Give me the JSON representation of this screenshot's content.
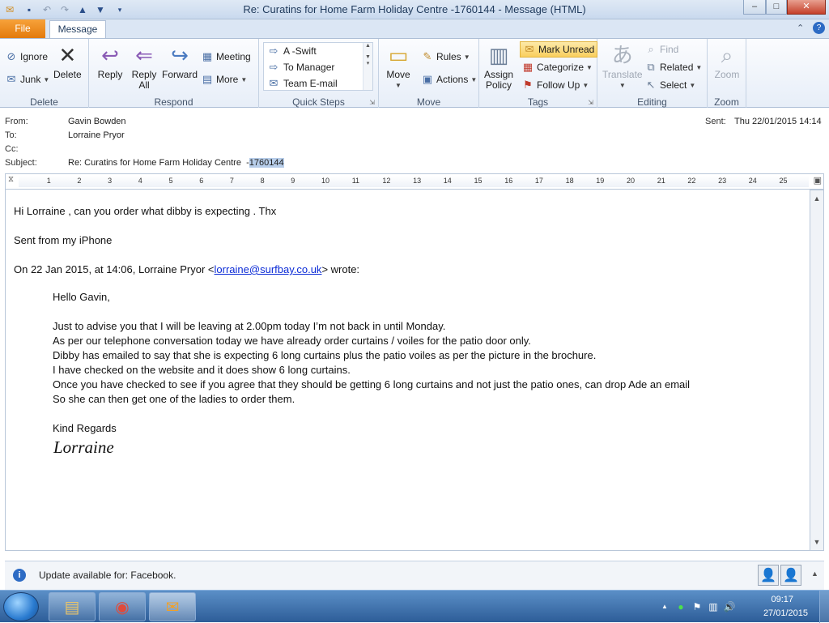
{
  "window": {
    "title": "Re: Curatins for Home Farm Holiday Centre  -1760144  -  Message (HTML)",
    "minimize": "–",
    "maximize": "□",
    "close": "✕"
  },
  "tabs": {
    "file": "File",
    "message": "Message"
  },
  "ribbon": {
    "delete": {
      "label": "Delete",
      "ignore": "Ignore",
      "junk": "Junk",
      "delete": "Delete"
    },
    "respond": {
      "label": "Respond",
      "reply": "Reply",
      "reply_all_1": "Reply",
      "reply_all_2": "All",
      "forward": "Forward",
      "meeting": "Meeting",
      "more": "More"
    },
    "quick_steps": {
      "label": "Quick Steps",
      "items": [
        "A -Swift",
        "To Manager",
        "Team E-mail"
      ]
    },
    "move": {
      "label": "Move",
      "move": "Move",
      "rules": "Rules",
      "actions": "Actions"
    },
    "tags": {
      "label": "Tags",
      "assign_policy_1": "Assign",
      "assign_policy_2": "Policy",
      "mark_unread": "Mark Unread",
      "categorize": "Categorize",
      "follow_up": "Follow Up"
    },
    "editing": {
      "label": "Editing",
      "translate": "Translate",
      "find": "Find",
      "related": "Related",
      "select": "Select"
    },
    "zoom": {
      "label": "Zoom",
      "zoom": "Zoom"
    }
  },
  "header": {
    "from_label": "From:",
    "from": "Gavin Bowden",
    "to_label": "To:",
    "to": "Lorraine Pryor",
    "cc_label": "Cc:",
    "subject_label": "Subject:",
    "subject": "Re: Curatins for Home Farm Holiday Centre  -",
    "subject_code": "1760144",
    "sent_label": "Sent:",
    "sent": "Thu 22/01/2015 14:14"
  },
  "ruler": {
    "numbers": [
      "1",
      "2",
      "3",
      "4",
      "5",
      "6",
      "7",
      "8",
      "9",
      "10",
      "11",
      "12",
      "13",
      "14",
      "15",
      "16",
      "17",
      "18",
      "19",
      "20",
      "21",
      "22",
      "23",
      "24",
      "25"
    ]
  },
  "message": {
    "line1": "Hi Lorraine , can you order what dibby is expecting . Thx",
    "line2": "Sent from my iPhone",
    "quote_prefix": "On 22 Jan 2015, at 14:06, Lorraine Pryor <",
    "quote_email": "lorraine@surfbay.co.uk",
    "quote_suffix": "> wrote:",
    "greeting": "Hello Gavin,",
    "body": [
      "Just to advise you that I will be leaving at 2.00pm today I’m not back in until Monday.",
      "As per our telephone conversation today we have already order curtains / voiles for the patio door only.",
      "Dibby has emailed to say that she is expecting 6 long curtains plus the patio voiles as per the picture in the brochure.",
      "I have checked on the website and it does show 6 long curtains.",
      "Once you have checked to see if you agree that they should be getting 6 long curtains and not just the patio ones, can drop Ade an email",
      "So she can then get one of  the ladies to order them."
    ],
    "closing": "Kind Regards",
    "signature": "Lorraine"
  },
  "infobar": {
    "text": "Update available for: Facebook."
  },
  "taskbar": {
    "time": "09:17",
    "date": "27/01/2015"
  }
}
